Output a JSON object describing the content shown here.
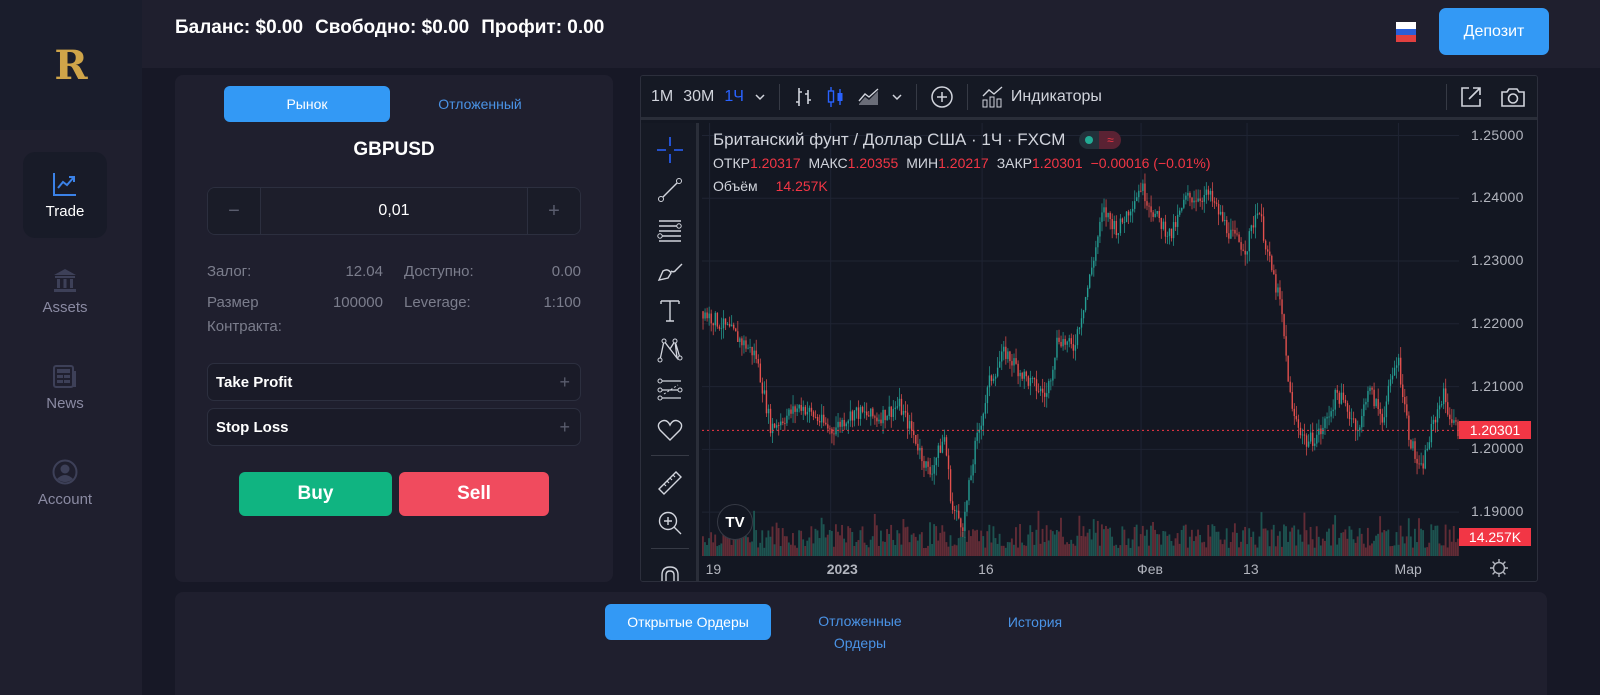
{
  "brand": {
    "logo_letter": "R",
    "logo_color": "#cfa449"
  },
  "sidebar": {
    "items": [
      {
        "label": "Trade",
        "icon": "trending-chart-icon",
        "active": true
      },
      {
        "label": "Assets",
        "icon": "bank-icon",
        "active": false
      },
      {
        "label": "News",
        "icon": "newspaper-icon",
        "active": false
      },
      {
        "label": "Account",
        "icon": "user-circle-icon",
        "active": false
      }
    ]
  },
  "header": {
    "balance": "Баланс: $0.00",
    "free": "Свободно: $0.00",
    "profit": "Профит: 0.00",
    "language_flag": "ru",
    "deposit_label": "Депозит"
  },
  "order_panel": {
    "tabs": [
      {
        "label": "Рынок",
        "active": true
      },
      {
        "label": "Отложенный",
        "active": false
      }
    ],
    "symbol": "GBPUSD",
    "volume": "0,01",
    "minus": "−",
    "plus": "+",
    "info": {
      "margin_label": "Залог:",
      "margin_value": "12.04",
      "available_label": "Доступно:",
      "available_value": "0.00",
      "contract_label_1": "Размер",
      "contract_label_2": "Контракта:",
      "contract_value": "100000",
      "leverage_label": "Leverage:",
      "leverage_value": "1:100"
    },
    "take_profit_label": "Take Profit",
    "stop_loss_label": "Stop Loss",
    "expand_icon": "+",
    "buy_label": "Buy",
    "sell_label": "Sell",
    "colors": {
      "accent": "#3399f5",
      "buy": "#10b481",
      "sell": "#f04b5e"
    }
  },
  "chart_toolbar": {
    "intervals": [
      {
        "label": "1M",
        "active": false
      },
      {
        "label": "30M",
        "active": false
      },
      {
        "label": "1Ч",
        "active": true
      }
    ],
    "indicators_label": "Индикаторы"
  },
  "chart_legend": {
    "title": "Британский фунт / Доллар США · 1Ч · FXCM",
    "open_label": "ОТКР",
    "open": "1.20317",
    "high_label": "МАКС",
    "high": "1.20355",
    "low_label": "МИН",
    "low": "1.20217",
    "close_label": "ЗАКР",
    "close": "1.20301",
    "change": "−0.00016 (−0.01%)",
    "volume_label": "Объём",
    "volume": "14.257K"
  },
  "chart_data": {
    "type": "candlestick",
    "title": "Британский фунт / Доллар США · 1Ч · FXCM",
    "y_ticks": [
      "1.25000",
      "1.24000",
      "1.23000",
      "1.22000",
      "1.21000",
      "1.20000",
      "1.19000"
    ],
    "ylim": [
      1.183,
      1.252
    ],
    "x_ticks": [
      "19",
      "2023",
      "16",
      "Фев",
      "13",
      "Мар"
    ],
    "x_ticks_bold": [
      "2023"
    ],
    "last_price": "1.20301",
    "last_volume": "14.257K",
    "price_path": [
      {
        "t": 0.0,
        "p": 1.222
      },
      {
        "t": 0.04,
        "p": 1.2185
      },
      {
        "t": 0.07,
        "p": 1.215
      },
      {
        "t": 0.09,
        "p": 1.2035
      },
      {
        "t": 0.13,
        "p": 1.207
      },
      {
        "t": 0.17,
        "p": 1.203
      },
      {
        "t": 0.2,
        "p": 1.206
      },
      {
        "t": 0.23,
        "p": 1.205
      },
      {
        "t": 0.26,
        "p": 1.207
      },
      {
        "t": 0.28,
        "p": 1.202
      },
      {
        "t": 0.3,
        "p": 1.196
      },
      {
        "t": 0.32,
        "p": 1.202
      },
      {
        "t": 0.33,
        "p": 1.1905
      },
      {
        "t": 0.345,
        "p": 1.188
      },
      {
        "t": 0.36,
        "p": 1.2
      },
      {
        "t": 0.38,
        "p": 1.211
      },
      {
        "t": 0.4,
        "p": 1.2155
      },
      {
        "t": 0.43,
        "p": 1.211
      },
      {
        "t": 0.455,
        "p": 1.2085
      },
      {
        "t": 0.47,
        "p": 1.218
      },
      {
        "t": 0.49,
        "p": 1.216
      },
      {
        "t": 0.51,
        "p": 1.226
      },
      {
        "t": 0.53,
        "p": 1.238
      },
      {
        "t": 0.55,
        "p": 1.235
      },
      {
        "t": 0.58,
        "p": 1.242
      },
      {
        "t": 0.6,
        "p": 1.237
      },
      {
        "t": 0.62,
        "p": 1.234
      },
      {
        "t": 0.64,
        "p": 1.24
      },
      {
        "t": 0.67,
        "p": 1.2405
      },
      {
        "t": 0.7,
        "p": 1.234
      },
      {
        "t": 0.72,
        "p": 1.232
      },
      {
        "t": 0.735,
        "p": 1.239
      },
      {
        "t": 0.75,
        "p": 1.23
      },
      {
        "t": 0.765,
        "p": 1.223
      },
      {
        "t": 0.78,
        "p": 1.206
      },
      {
        "t": 0.8,
        "p": 1.201
      },
      {
        "t": 0.82,
        "p": 1.203
      },
      {
        "t": 0.84,
        "p": 1.209
      },
      {
        "t": 0.86,
        "p": 1.205
      },
      {
        "t": 0.87,
        "p": 1.203
      },
      {
        "t": 0.88,
        "p": 1.21
      },
      {
        "t": 0.9,
        "p": 1.205
      },
      {
        "t": 0.92,
        "p": 1.215
      },
      {
        "t": 0.935,
        "p": 1.2025
      },
      {
        "t": 0.95,
        "p": 1.196
      },
      {
        "t": 0.965,
        "p": 1.203
      },
      {
        "t": 0.98,
        "p": 1.209
      },
      {
        "t": 0.99,
        "p": 1.205
      },
      {
        "t": 1.0,
        "p": 1.203
      }
    ],
    "grid": true,
    "has_volume_pane": true
  },
  "chart_time_axis_note": "Mar",
  "orders": {
    "tabs": [
      {
        "label": "Открытые Ордеры",
        "active": true
      },
      {
        "label": "Отложенные Ордеры",
        "active": false
      },
      {
        "label": "История",
        "active": false
      }
    ]
  }
}
